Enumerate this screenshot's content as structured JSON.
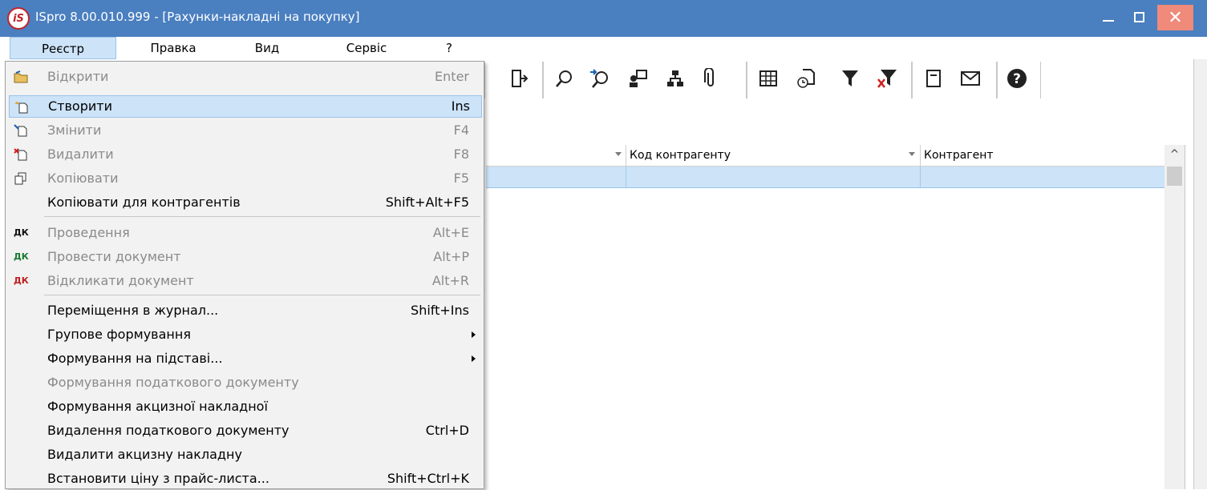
{
  "window": {
    "logo_text": "iS",
    "title": "ISpro 8.00.010.999 - [Рахунки-накладні на покупку]",
    "close_glyph": "✕"
  },
  "menubar": [
    {
      "label": "Реєстр",
      "active": true
    },
    {
      "label": "Правка"
    },
    {
      "label": "Вид"
    },
    {
      "label": "Сервіс"
    },
    {
      "label": "?"
    }
  ],
  "toolbar": {
    "icons": [
      "exit-icon",
      "search-icon",
      "search-next-icon",
      "user-card-icon",
      "hierarchy-icon",
      "attachment-icon",
      "table-icon",
      "doc-clock-icon",
      "filter-icon",
      "filter-clear-icon",
      "note-icon",
      "mail-icon",
      "help-icon"
    ]
  },
  "grid": {
    "columns": [
      {
        "label": "",
        "sortable": true
      },
      {
        "label": "Код контрагенту",
        "sortable": true
      },
      {
        "label": "Контрагент",
        "sortable": false
      }
    ],
    "scroll_up_glyph": "^"
  },
  "dropdown": {
    "items": [
      {
        "label": "Відкрити",
        "shortcut": "Enter",
        "disabled": true,
        "icon": "open-folder-icon"
      },
      {
        "label": "Створити",
        "shortcut": "Ins",
        "disabled": false,
        "selected": true,
        "icon": "new-doc-icon"
      },
      {
        "label": "Змінити",
        "shortcut": "F4",
        "disabled": true,
        "icon": "edit-doc-icon"
      },
      {
        "label": "Видалити",
        "shortcut": "F8",
        "disabled": true,
        "icon": "delete-doc-icon"
      },
      {
        "label": "Копіювати",
        "shortcut": "F5",
        "disabled": true,
        "icon": "copy-icon"
      },
      {
        "label": "Копіювати для контрагентів",
        "shortcut": "Shift+Alt+F5",
        "disabled": false
      },
      {
        "separator": true
      },
      {
        "label": "Проведення",
        "shortcut": "Alt+E",
        "disabled": true,
        "icon": "posting-icon",
        "icon_text": "ДК"
      },
      {
        "label": "Провести документ",
        "shortcut": "Alt+P",
        "disabled": true,
        "icon": "post-doc-icon",
        "icon_text": "ДК"
      },
      {
        "label": "Відкликати документ",
        "shortcut": "Alt+R",
        "disabled": true,
        "icon": "revoke-doc-icon",
        "icon_text": "ДК"
      },
      {
        "separator": true
      },
      {
        "label": "Переміщення в журнал...",
        "shortcut": "Shift+Ins",
        "disabled": false
      },
      {
        "label": "Групове формування",
        "shortcut": "",
        "disabled": false,
        "submenu": true
      },
      {
        "label": "Формування на підставі...",
        "shortcut": "",
        "disabled": false,
        "submenu": true
      },
      {
        "label": "Формування податкового документу",
        "shortcut": "",
        "disabled": true
      },
      {
        "label": "Формування акцизної накладної",
        "shortcut": "",
        "disabled": false
      },
      {
        "label": "Видалення податкового документу",
        "shortcut": "Ctrl+D",
        "disabled": false
      },
      {
        "label": "Видалити акцизну накладну",
        "shortcut": "",
        "disabled": false
      },
      {
        "label": "Встановити ціну з прайс-листа...",
        "shortcut": "Shift+Ctrl+K",
        "disabled": false
      }
    ]
  }
}
